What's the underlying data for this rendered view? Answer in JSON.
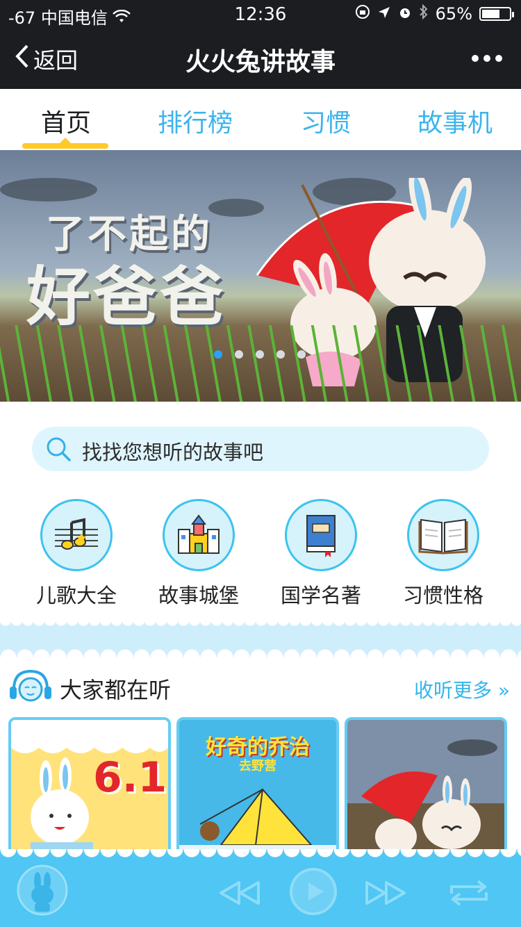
{
  "status_bar": {
    "signal": "-67",
    "carrier": "中国电信",
    "time": "12:36",
    "battery": "65%",
    "battery_level": 0.65
  },
  "nav": {
    "back_label": "返回",
    "title": "火火兔讲故事"
  },
  "tabs": [
    {
      "label": "首页",
      "active": true
    },
    {
      "label": "排行榜"
    },
    {
      "label": "习惯"
    },
    {
      "label": "故事机"
    }
  ],
  "banner": {
    "line1": "了不起的",
    "line2": "好爸爸",
    "slide_count": 5,
    "active_slide": 1
  },
  "search": {
    "placeholder": "找找您想听的故事吧"
  },
  "categories": [
    {
      "label": "儿歌大全",
      "icon": "music-note-icon"
    },
    {
      "label": "故事城堡",
      "icon": "castle-icon"
    },
    {
      "label": "国学名著",
      "icon": "book-icon"
    },
    {
      "label": "习惯性格",
      "icon": "open-book-icon"
    }
  ],
  "section": {
    "title": "大家都在听",
    "more_label": "收听更多 »"
  },
  "cards": [
    {
      "image": "6.1"
    },
    {
      "image_title": "好奇的乔治",
      "image_subtitle": "去野营"
    },
    {
      "image": "umbrella-rabbits"
    }
  ],
  "colors": {
    "accent": "#3cb4ec",
    "nav_bg": "#1b1d21",
    "indicator": "#ffc928",
    "player_bg": "#4fc6f3"
  }
}
